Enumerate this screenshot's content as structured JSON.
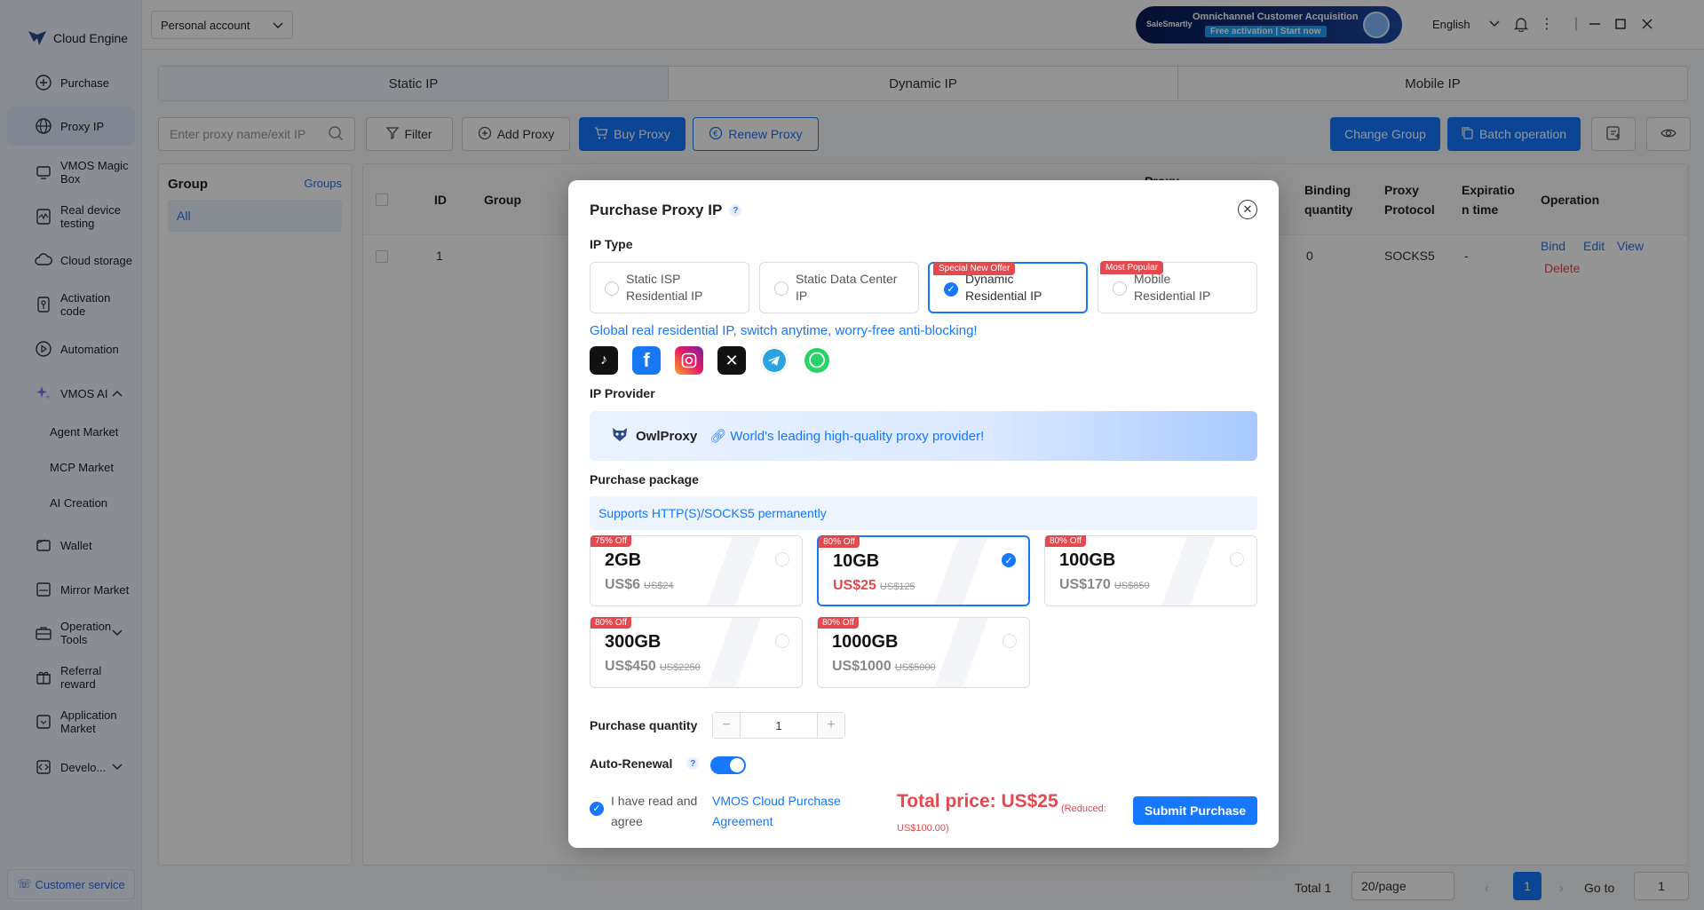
{
  "sidebar": {
    "brand": "Cloud Engine",
    "items": [
      {
        "label": "Purchase"
      },
      {
        "label": "Proxy IP"
      },
      {
        "label": "VMOS Magic Box"
      },
      {
        "label": "Real device testing"
      },
      {
        "label": "Cloud storage"
      },
      {
        "label": "Activation code"
      },
      {
        "label": "Automation"
      },
      {
        "label": "VMOS AI"
      },
      {
        "label": "Agent Market"
      },
      {
        "label": "MCP Market"
      },
      {
        "label": "AI Creation"
      },
      {
        "label": "Wallet"
      },
      {
        "label": "Mirror Market"
      },
      {
        "label": "Operation Tools"
      },
      {
        "label": "Referral reward"
      },
      {
        "label": "Application Market"
      },
      {
        "label": "Develo..."
      }
    ],
    "customer_service": "Customer service"
  },
  "topbar": {
    "account": "Personal account",
    "ad_title": "Omnichannel Customer Acquisition",
    "ad_cta": "Free activation | Start now",
    "ad_brand": "SaleSmartly",
    "language": "English"
  },
  "main": {
    "tabs": [
      "Static IP",
      "Dynamic IP",
      "Mobile IP"
    ],
    "search_placeholder": "Enter proxy name/exit IP",
    "filter": "Filter",
    "add_proxy": "Add Proxy",
    "buy_proxy": "Buy Proxy",
    "renew_proxy": "Renew Proxy",
    "change_group": "Change Group",
    "batch_operation": "Batch operation",
    "group_title": "Group",
    "groups_link": "Groups",
    "group_all": "All",
    "columns": {
      "id": "ID",
      "group": "Group",
      "proxy": "Proxy",
      "binding": "Binding quantity",
      "protocol": "Proxy Protocol",
      "expiration": "Expiratio n time",
      "operation": "Operation"
    },
    "row": {
      "id": "1",
      "binding": "0",
      "protocol": "SOCKS5",
      "expiration": "-",
      "bind": "Bind",
      "edit": "Edit",
      "view": "View",
      "delete": "Delete"
    },
    "pager": {
      "total": "Total 1",
      "per_page": "20/page",
      "current": "1",
      "goto_label": "Go to",
      "goto_value": "1"
    }
  },
  "modal": {
    "title": "Purchase Proxy IP",
    "ip_type_label": "IP Type",
    "ip_types": [
      {
        "label": "Static ISP Residential IP",
        "badge": ""
      },
      {
        "label": "Static Data Center IP",
        "badge": ""
      },
      {
        "label": "Dynamic Residential IP",
        "badge": "Special New Offer"
      },
      {
        "label": "Mobile Residential IP",
        "badge": "Most Popular"
      }
    ],
    "tagline": "Global real residential IP, switch anytime, worry-free anti-blocking!",
    "provider_label": "IP Provider",
    "provider_name": "OwlProxy",
    "provider_desc": "World's leading high-quality proxy provider!",
    "package_label": "Purchase package",
    "supports": "Supports HTTP(S)/SOCKS5 permanently",
    "packages": [
      {
        "off": "75% Off",
        "size": "2GB",
        "price": "US$6",
        "orig": "US$24"
      },
      {
        "off": "80% Off",
        "size": "10GB",
        "price": "US$25",
        "orig": "US$125"
      },
      {
        "off": "80% Off",
        "size": "100GB",
        "price": "US$170",
        "orig": "US$850"
      },
      {
        "off": "80% Off",
        "size": "300GB",
        "price": "US$450",
        "orig": "US$2250"
      },
      {
        "off": "80% Off",
        "size": "1000GB",
        "price": "US$1000",
        "orig": "US$5000"
      }
    ],
    "quantity_label": "Purchase quantity",
    "quantity": "1",
    "auto_renewal_label": "Auto-Renewal",
    "agree_text": "I have read and agree",
    "agreement_link": "VMOS Cloud Purchase Agreement",
    "total": "Total price: US$25",
    "reduced": "(Reduced: US$100.00)",
    "submit": "Submit Purchase"
  },
  "colors": {
    "accent": "#1677ff",
    "danger": "#e5484d",
    "sidebar_bg": "#eef3fd"
  }
}
